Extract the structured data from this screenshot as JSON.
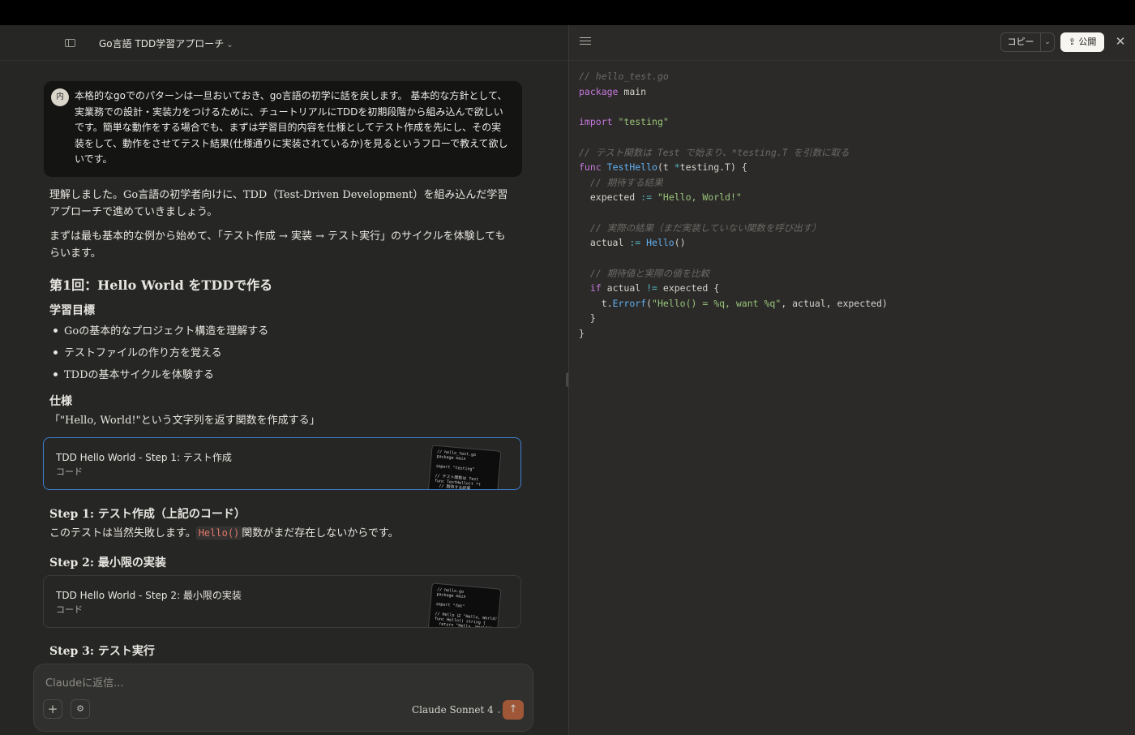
{
  "header": {
    "conversation_title": "Go言語 TDD学習アプローチ"
  },
  "user_message": {
    "avatar_initial": "内",
    "text": "本格的なgoでのパターンは一旦おいておき、go言語の初学に話を戻します。 基本的な方針として、実業務での設計・実装力をつけるために、チュートリアルにTDDを初期段階から組み込んで欲しいです。簡単な動作をする場合でも、まずは学習目的内容を仕様としてテスト作成を先にし、その実装をして、動作をさせてテスト結果(仕様通りに実装されているか)を見るというフローで教えて欲しいです。"
  },
  "reply": {
    "p1": "理解しました。Go言語の初学者向けに、TDD（Test-Driven Development）を組み込んだ学習アプローチで進めていきましょう。",
    "p2": "まずは最も基本的な例から始めて、「テスト作成 → 実装 → テスト実行」のサイクルを体験してもらいます。",
    "h_lesson": "第1回：Hello World をTDDで作る",
    "h_goals": "学習目標",
    "goals": [
      "Goの基本的なプロジェクト構造を理解する",
      "テストファイルの作り方を覚える",
      "TDDの基本サイクルを体験する"
    ],
    "h_spec": "仕様",
    "spec": "「\"Hello, World!\"という文字列を返す関数を作成する」",
    "artifact1": {
      "title": "TDD Hello World - Step 1: テスト作成",
      "subtitle": "コード"
    },
    "h_step1": "Step 1: テスト作成（上記のコード）",
    "step1_text_before": "このテストは当然失敗します。",
    "step1_code": "Hello()",
    "step1_text_after": "関数がまだ存在しないからです。",
    "h_step2": "Step 2: 最小限の実装",
    "artifact2": {
      "title": "TDD Hello World - Step 2: 最小限の実装",
      "subtitle": "コード"
    },
    "h_step3": "Step 3: テスト実行"
  },
  "composer": {
    "placeholder": "Claudeに返信...",
    "model": "Claude Sonnet 4"
  },
  "artifact_panel": {
    "copy_label": "コピー",
    "publish_label": "公開"
  },
  "icons": {
    "sidebar": "sidebar-toggle-icon",
    "list": "list-icon",
    "close": "close-icon",
    "send": "arrow-up-icon",
    "plus": "plus-icon",
    "tools": "sliders-icon",
    "share": "share-icon"
  },
  "colors": {
    "accent_send": "#c5643c",
    "active_artifact_border": "#3f7fd0",
    "inline_code": "#e2786d"
  }
}
